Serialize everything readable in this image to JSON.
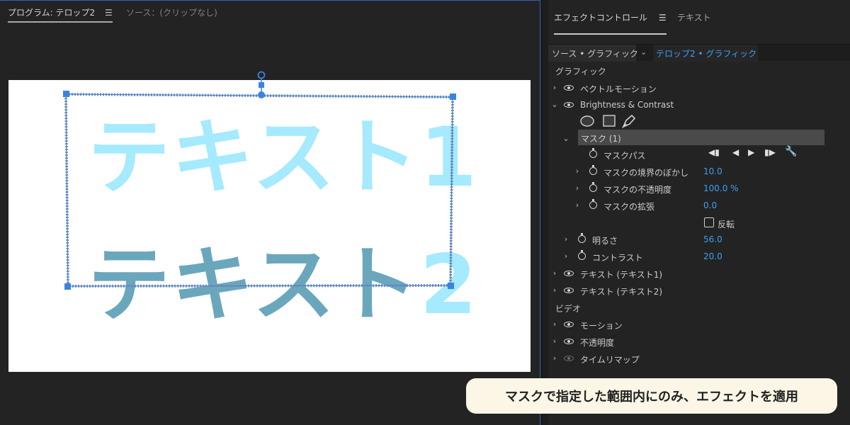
{
  "program_monitor": {
    "tab_program": "プログラム: テロップ2",
    "tab_source": "ソース：(クリップなし)",
    "canvas_text_1": "テキスト1",
    "canvas_text_2_prefix": "テキスト",
    "canvas_text_2_suffix": "2"
  },
  "effect_controls": {
    "tab_effects": "エフェクトコントロール",
    "tab_text": "テキスト",
    "clip_source": "ソース • グラフィック",
    "clip_target": "テロップ2 • グラフィック",
    "section_graphic": "グラフィック",
    "vector_motion": "ベクトルモーション",
    "brightness_contrast": "Brightness & Contrast",
    "mask_name": "マスク (1)",
    "mask_path": "マスクパス",
    "mask_feather_label": "マスクの境界のぼかし",
    "mask_feather_value": "10.0",
    "mask_opacity_label": "マスクの不透明度",
    "mask_opacity_value": "100.0 %",
    "mask_expansion_label": "マスクの拡張",
    "mask_expansion_value": "0.0",
    "invert_label": "反転",
    "brightness_label": "明るさ",
    "brightness_value": "56.0",
    "contrast_label": "コントラスト",
    "contrast_value": "20.0",
    "text_layer_1": "テキスト (テキスト1)",
    "text_layer_2": "テキスト (テキスト2)",
    "section_video": "ビデオ",
    "motion": "モーション",
    "opacity": "不透明度",
    "time_remap": "タイムリマップ"
  },
  "caption": "マスクで指定した範囲内にのみ、エフェクトを適用",
  "colors": {
    "accent_blue": "#3d9ff5",
    "text_light": "#a5eaff",
    "text_dark": "#6aa7bd",
    "selection_blue": "#3a84e0"
  }
}
